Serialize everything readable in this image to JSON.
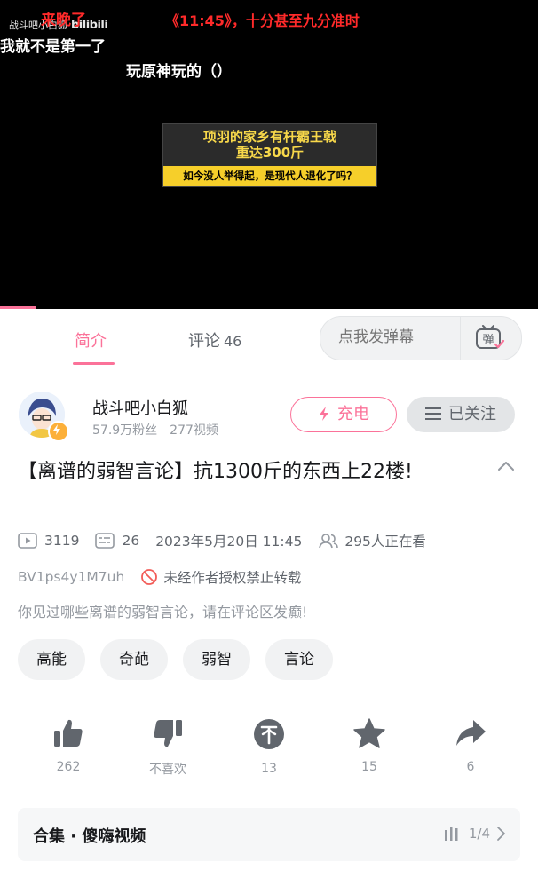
{
  "player": {
    "watermark_author": "战斗吧小白狐",
    "watermark_logo": "bilibili",
    "danmaku": [
      "来晚了",
      "《11:45》，十分甚至九分准时",
      "我就不是第一了",
      "玩原神玩的（）"
    ],
    "thumb_title_line1": "项羽的家乡有杆霸王戟",
    "thumb_title_line2": "重达300斤",
    "thumb_subtitle": "如今没人举得起，是现代人退化了吗？",
    "progress_fraction": 0.066
  },
  "tabs": {
    "intro": "简介",
    "comments": "评论",
    "comments_count": "46"
  },
  "danmu": {
    "placeholder": "点我发弹幕",
    "button": "弹"
  },
  "author": {
    "name": "战斗吧小白狐",
    "fans": "57.9万粉丝",
    "videos": "277视频",
    "charge": "充电",
    "follow": "已关注"
  },
  "video": {
    "title": "【离谱的弱智言论】抗1300斤的东西上22楼!",
    "views": "3119",
    "danmaku_count": "26",
    "date": "2023年5月20日 11:45",
    "watching": "295人正在看",
    "bvid": "BV1ps4y1M7uh",
    "copyright": "未经作者授权禁止转载",
    "description": "你见过哪些离谱的弱智言论，请在评论区发癫!"
  },
  "tags": [
    "高能",
    "奇葩",
    "弱智",
    "言论"
  ],
  "actions": {
    "like": "262",
    "dislike": "不喜欢",
    "coin": "13",
    "favorite": "15",
    "share": "6"
  },
  "collection": {
    "title": "合集 · 傻嗨视频",
    "progress": "1/4"
  },
  "colors": {
    "accent": "#fb7299",
    "text": "#18191c",
    "secondary": "#9499a0"
  }
}
